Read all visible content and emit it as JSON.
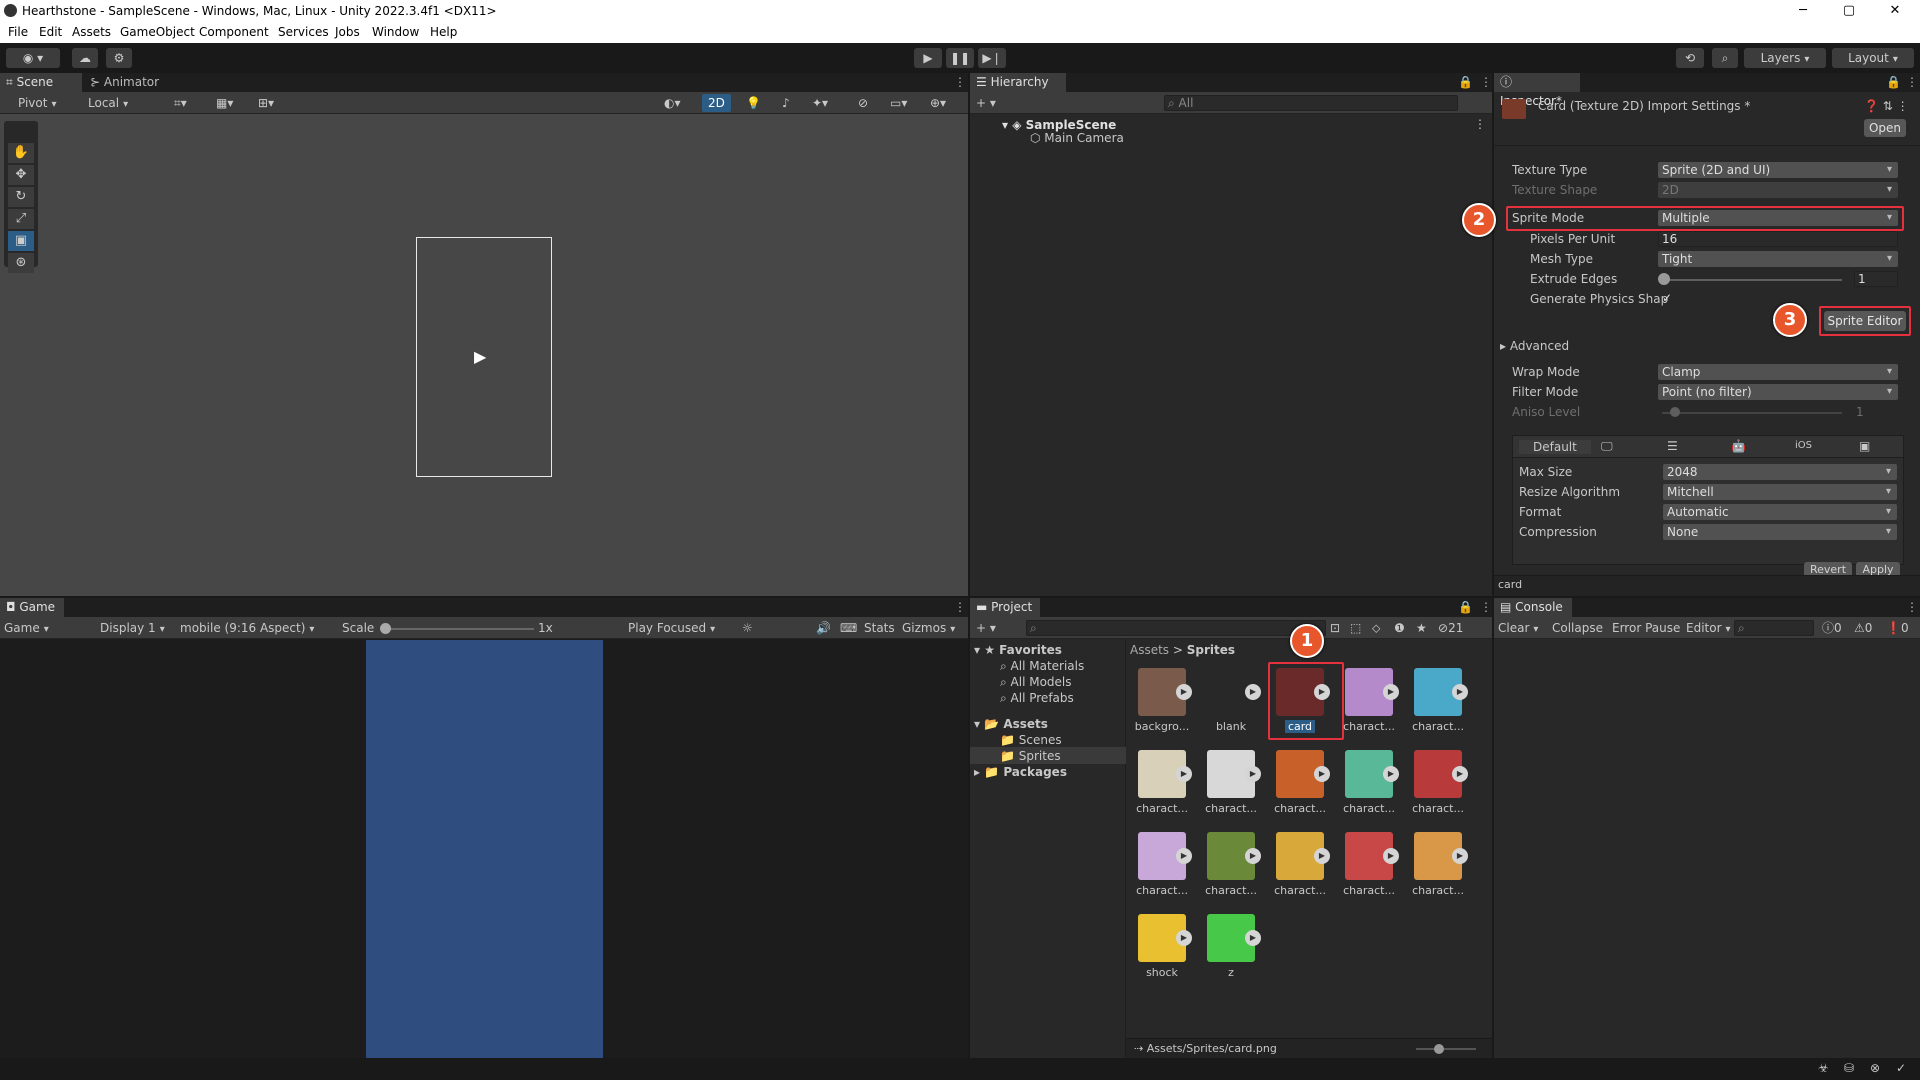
{
  "window": {
    "title": "Hearthstone - SampleScene - Windows, Mac, Linux - Unity 2022.3.4f1 <DX11>",
    "minimize": "─",
    "maximize": "▢",
    "close": "✕"
  },
  "menu": [
    "File",
    "Edit",
    "Assets",
    "GameObject",
    "Component",
    "Services",
    "Jobs",
    "Window",
    "Help"
  ],
  "toolbar": {
    "layers": "Layers",
    "layout": "Layout"
  },
  "scene": {
    "tabs": [
      "Scene",
      "Animator"
    ],
    "pivot": "Pivot",
    "local": "Local",
    "mode2d": "2D"
  },
  "hierarchy": {
    "tab": "Hierarchy",
    "search_placeholder": "All",
    "scene": "SampleScene",
    "items": [
      "Main Camera"
    ]
  },
  "inspector": {
    "tab": "Inspector*",
    "title": "Card (Texture 2D) Import Settings *",
    "open": "Open",
    "texture_type_label": "Texture Type",
    "texture_type": "Sprite (2D and UI)",
    "texture_shape_label": "Texture Shape",
    "texture_shape": "2D",
    "sprite_mode_label": "Sprite Mode",
    "sprite_mode": "Multiple",
    "ppu_label": "Pixels Per Unit",
    "ppu": "16",
    "mesh_type_label": "Mesh Type",
    "mesh_type": "Tight",
    "extrude_label": "Extrude Edges",
    "extrude": "1",
    "extrude_fraction": 0.0,
    "physics_label": "Generate Physics Shap",
    "physics_checked": true,
    "sprite_editor": "Sprite Editor",
    "advanced": "Advanced",
    "wrap_label": "Wrap Mode",
    "wrap": "Clamp",
    "filter_label": "Filter Mode",
    "filter": "Point (no filter)",
    "aniso_label": "Aniso Level",
    "aniso": "1",
    "platform_tabs": [
      "Default",
      "iOS"
    ],
    "max_size_label": "Max Size",
    "max_size": "2048",
    "resize_label": "Resize Algorithm",
    "resize": "Mitchell",
    "format_label": "Format",
    "format": "Automatic",
    "compression_label": "Compression",
    "compression": "None",
    "revert": "Revert",
    "apply": "Apply",
    "footer": "card"
  },
  "game": {
    "tab": "Game",
    "view": "Game",
    "display": "Display 1",
    "aspect": "mobile (9:16 Aspect)",
    "scale_label": "Scale",
    "scale_value": "1x",
    "play_focused": "Play Focused",
    "stats": "Stats",
    "gizmos": "Gizmos",
    "bg_color": "#2f4e7f"
  },
  "project": {
    "tab": "Project",
    "hidden_count": "21",
    "favorites": "Favorites",
    "fav_items": [
      "All Materials",
      "All Models",
      "All Prefabs"
    ],
    "assets": "Assets",
    "asset_folders": [
      "Scenes",
      "Sprites"
    ],
    "packages": "Packages",
    "breadcrumb": [
      "Assets",
      "Sprites"
    ],
    "items": [
      "backgro...",
      "blank",
      "card",
      "charact...",
      "charact...",
      "charact...",
      "charact...",
      "charact...",
      "charact...",
      "charact...",
      "charact...",
      "charact...",
      "charact...",
      "charact...",
      "charact...",
      "shock",
      "z"
    ],
    "path": "Assets/Sprites/card.png"
  },
  "console": {
    "tab": "Console",
    "clear": "Clear",
    "collapse": "Collapse",
    "error_pause": "Error Pause",
    "editor": "Editor",
    "logs": "0",
    "warnings": "0",
    "errors": "0"
  },
  "annotations": [
    "1",
    "2",
    "3"
  ],
  "colors": {
    "highlight": "#e5303d",
    "badge": "#e8562c",
    "selection": "#2c5d87"
  }
}
